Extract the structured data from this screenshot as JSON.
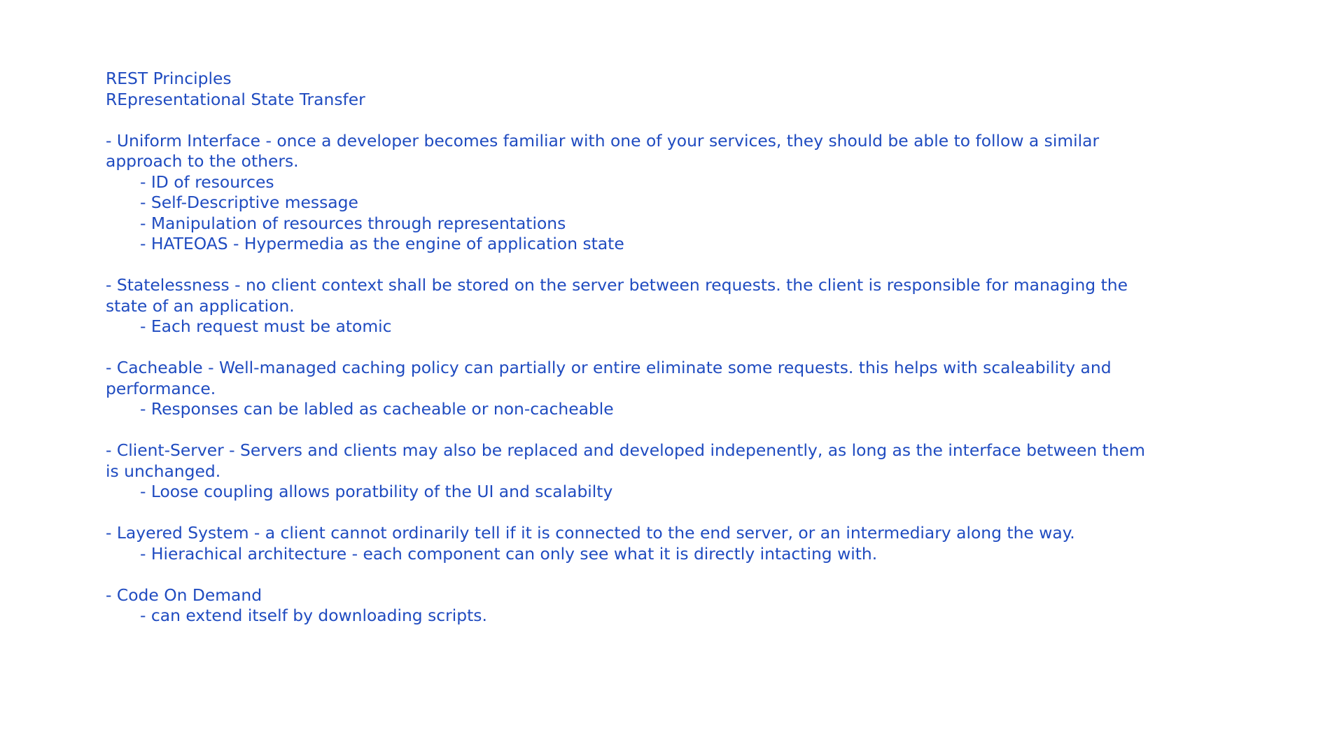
{
  "document": {
    "title": "REST Principles",
    "subtitle": "REpresentational State Transfer",
    "sections": [
      {
        "heading": "- Uniform Interface - once a developer becomes familiar with one of your services, they should be able to follow a similar approach to the others.",
        "items": [
          "- ID of resources",
          "- Self-Descriptive message",
          "- Manipulation of resources through representations",
          "- HATEOAS - Hypermedia as the engine of application state"
        ]
      },
      {
        "heading": "- Statelessness - no client context shall be stored on the server between requests. the client is responsible for managing the state of an application.",
        "items": [
          "- Each request must be atomic"
        ]
      },
      {
        "heading": "- Cacheable - Well-managed caching policy can partially or entire eliminate some requests. this helps with scaleability and performance.",
        "items": [
          "- Responses can be labled as cacheable or non-cacheable"
        ]
      },
      {
        "heading": "- Client-Server - Servers and clients may also be replaced and developed indepenently, as long as the interface between them is unchanged.",
        "items": [
          "- Loose coupling allows poratbility of the UI and scalabilty"
        ]
      },
      {
        "heading": "- Layered System - a client cannot ordinarily tell if it is connected to the end server, or an intermediary along the way.",
        "items": [
          "- Hierachical architecture - each component can only see what it is directly intacting with."
        ]
      },
      {
        "heading": "- Code On Demand",
        "items": [
          "- can extend itself by downloading scripts."
        ]
      }
    ]
  }
}
